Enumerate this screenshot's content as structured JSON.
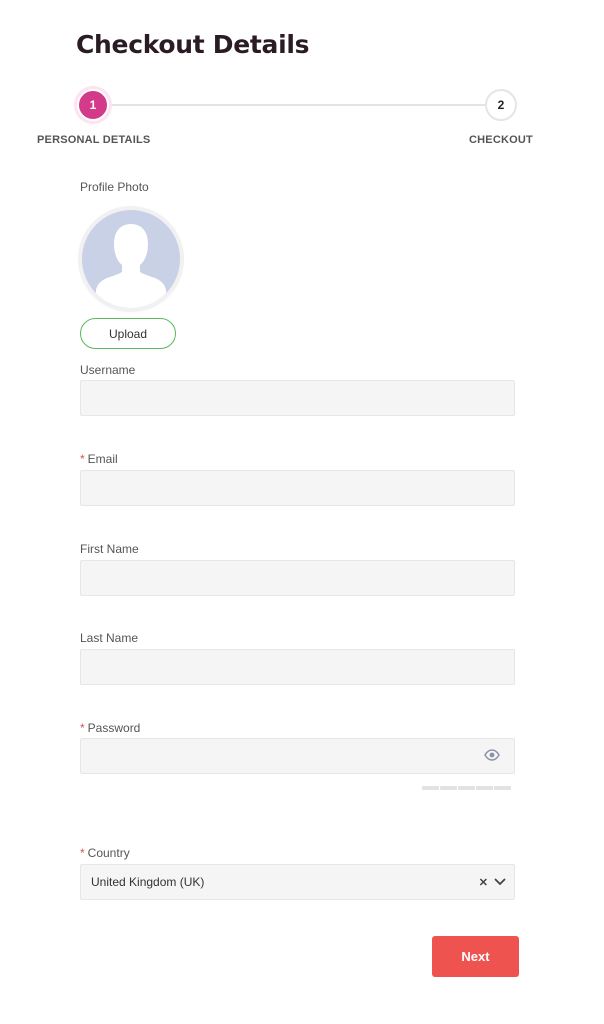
{
  "page": {
    "title": "Checkout Details"
  },
  "stepper": {
    "steps": [
      {
        "number": "1",
        "label": "PERSONAL DETAILS",
        "active": true
      },
      {
        "number": "2",
        "label": "CHECKOUT",
        "active": false
      }
    ],
    "accent_color": "#d33a8a"
  },
  "profile": {
    "label": "Profile Photo",
    "upload_label": "Upload",
    "avatar_icon": "person-silhouette-icon"
  },
  "form": {
    "username": {
      "label": "Username",
      "value": "",
      "required": false
    },
    "email": {
      "label": "Email",
      "value": "",
      "required": true
    },
    "first_name": {
      "label": "First Name",
      "value": "",
      "required": false
    },
    "last_name": {
      "label": "Last Name",
      "value": "",
      "required": false
    },
    "password": {
      "label": "Password",
      "value": "",
      "required": true,
      "icon": "eye-icon",
      "strength_segments": 5
    },
    "country": {
      "label": "Country",
      "value": "United Kingdom (UK)",
      "required": true,
      "clear_icon": "close-icon",
      "dropdown_icon": "chevron-down-icon"
    },
    "required_marker": "*"
  },
  "actions": {
    "next_label": "Next",
    "next_color": "#ee5350"
  }
}
